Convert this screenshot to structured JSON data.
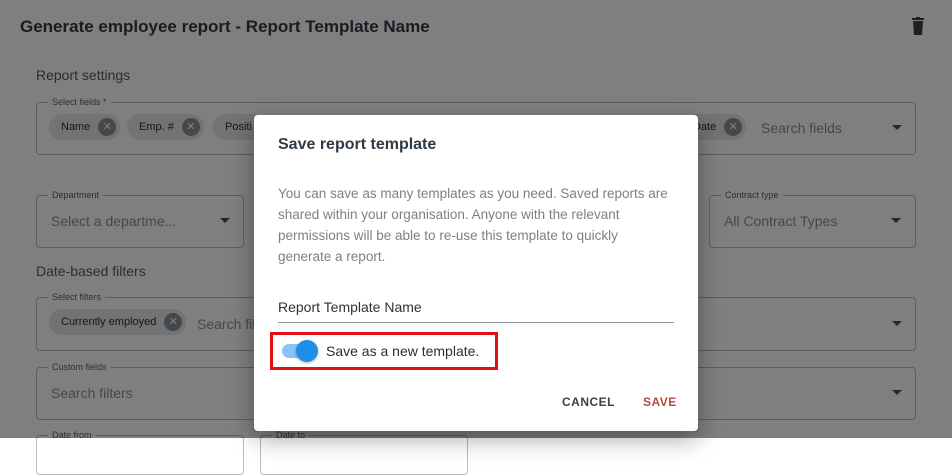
{
  "page": {
    "title": "Generate employee report - Report Template Name",
    "report_settings_label": "Report settings",
    "date_filters_label": "Date-based filters"
  },
  "select_fields": {
    "label": "Select fields *",
    "chips": [
      "Name",
      "Emp. #",
      "Positi",
      "Date"
    ],
    "placeholder": "Search fields"
  },
  "department": {
    "label": "Department",
    "placeholder": "Select a departme..."
  },
  "contract_type": {
    "label": "Contract type",
    "value": "All Contract Types"
  },
  "select_filters": {
    "label": "Select filters",
    "chips": [
      "Currently employed"
    ],
    "placeholder": "Search fil"
  },
  "custom_fields": {
    "label": "Custom fields",
    "placeholder": "Search filters"
  },
  "date_from": {
    "label": "Date from"
  },
  "date_to": {
    "label": "Date to"
  },
  "dialog": {
    "title": "Save report template",
    "body": "You can save as many templates as you need. Saved reports are shared within your organisation. Anyone with the relevant permissions will be able to re-use this template to quickly generate a report.",
    "template_name_value": "Report Template Name",
    "toggle_label": "Save as a new template.",
    "toggle_on": true,
    "cancel_label": "CANCEL",
    "save_label": "SAVE"
  },
  "colors": {
    "toggle_accent": "#1f8ee6",
    "save_button": "#b54a3c",
    "highlight_box": "#e01010"
  }
}
